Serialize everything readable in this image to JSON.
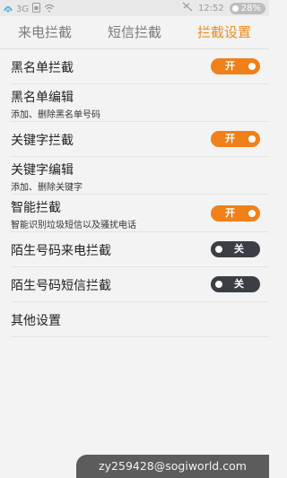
{
  "status_bar": {
    "network": "3G",
    "time": "12:52",
    "battery": "28%",
    "icons": [
      "signal-icon",
      "sim-icon",
      "wifi-icon",
      "mute-icon",
      "battery-icon"
    ]
  },
  "tabs": [
    {
      "label": "来电拦截",
      "active": false
    },
    {
      "label": "短信拦截",
      "active": false
    },
    {
      "label": "拦截设置",
      "active": true
    }
  ],
  "settings": {
    "blacklist": {
      "title": "黑名单拦截",
      "toggle": "开",
      "state": "on"
    },
    "blacklist_edit": {
      "title": "黑名单编辑",
      "subtitle": "添加、删除黑名单号码"
    },
    "keyword_block": {
      "title": "关键字拦截",
      "toggle": "开",
      "state": "on"
    },
    "keyword_edit": {
      "title": "关键字编辑",
      "subtitle": "添加、删除关键字"
    },
    "smart_block": {
      "title": "智能拦截",
      "subtitle": "智能识别垃圾短信以及骚扰电话",
      "toggle": "开",
      "state": "on"
    },
    "stranger_call": {
      "title": "陌生号码来电拦截",
      "toggle": "关",
      "state": "off"
    },
    "stranger_sms": {
      "title": "陌生号码短信拦截",
      "toggle": "关",
      "state": "off"
    },
    "other": {
      "title": "其他设置"
    }
  },
  "colors": {
    "accent": "#f0801a",
    "toggle_off": "#3b3f45",
    "active_tab": "#f28b1f"
  },
  "footer": {
    "watermark": "zy259428@sogiworld.com"
  }
}
